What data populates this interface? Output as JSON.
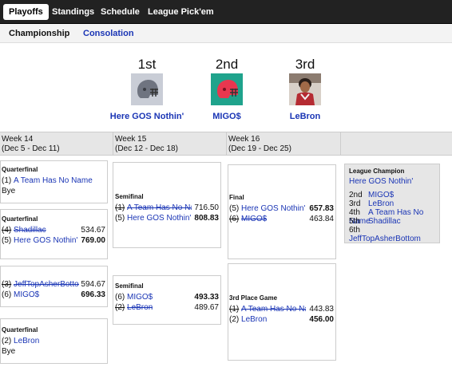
{
  "topnav": {
    "tabs": [
      {
        "label": "Playoffs"
      },
      {
        "label": "Standings"
      },
      {
        "label": "Schedule"
      },
      {
        "label": "League Pick'em"
      }
    ]
  },
  "subnav": {
    "championship": "Championship",
    "consolation": "Consolation"
  },
  "podium": [
    {
      "place": "1st",
      "team": "Here GOS Nothin'",
      "logo": "helmet-gray-icon"
    },
    {
      "place": "2nd",
      "team": "MIGO$",
      "logo": "helmet-red-icon"
    },
    {
      "place": "3rd",
      "team": "LeBron",
      "logo": "player-photo"
    }
  ],
  "weeks": [
    {
      "label": "Week 14",
      "dates": "(Dec 5 - Dec 11)"
    },
    {
      "label": "Week 15",
      "dates": "(Dec 12 - Dec 18)"
    },
    {
      "label": "Week 16",
      "dates": "(Dec 19 - Dec 25)"
    }
  ],
  "matchups": {
    "qf1": {
      "title": "Quarterfinal",
      "team1": {
        "seed": "(1)",
        "name": "A Team Has No Name"
      },
      "bye": "Bye"
    },
    "qf2": {
      "title": "Quarterfinal",
      "team1": {
        "seed": "(4)",
        "name": "Shadillac",
        "score": "534.67"
      },
      "team2": {
        "seed": "(5)",
        "name": "Here GOS Nothin'",
        "score": "769.00"
      }
    },
    "qf3": {
      "title": "Quarterfinal",
      "team1": {
        "seed": "(3)",
        "name": "JeffTopAsherBottom",
        "score": "594.67"
      },
      "team2": {
        "seed": "(6)",
        "name": "MIGO$",
        "score": "696.33"
      }
    },
    "qf4": {
      "title": "Quarterfinal",
      "team1": {
        "seed": "(2)",
        "name": "LeBron"
      },
      "bye": "Bye"
    },
    "sf1": {
      "title": "Semifinal",
      "team1": {
        "seed": "(1)",
        "name": "A Team Has No Name",
        "score": "716.50"
      },
      "team2": {
        "seed": "(5)",
        "name": "Here GOS Nothin'",
        "score": "808.83"
      }
    },
    "sf2": {
      "title": "Semifinal",
      "team1": {
        "seed": "(6)",
        "name": "MIGO$",
        "score": "493.33"
      },
      "team2": {
        "seed": "(2)",
        "name": "LeBron",
        "score": "489.67"
      }
    },
    "final": {
      "title": "Final",
      "team1": {
        "seed": "(5)",
        "name": "Here GOS Nothin'",
        "score": "657.83"
      },
      "team2": {
        "seed": "(6)",
        "name": "MIGO$",
        "score": "463.84"
      }
    },
    "third": {
      "title": "3rd Place Game",
      "team1": {
        "seed": "(1)",
        "name": "A Team Has No Name",
        "score": "443.83"
      },
      "team2": {
        "seed": "(2)",
        "name": "LeBron",
        "score": "456.00"
      }
    }
  },
  "champion": {
    "title": "League Champion",
    "winner": "Here GOS Nothin'",
    "places": [
      {
        "place": "2nd",
        "team": "MIGO$"
      },
      {
        "place": "3rd",
        "team": "LeBron"
      },
      {
        "place": "4th",
        "team": "A Team Has No Name"
      },
      {
        "place": "5th",
        "team": "Shadillac"
      },
      {
        "place": "6th",
        "team": "JeffTopAsherBottom"
      }
    ]
  },
  "colors": {
    "link": "#1a35b5",
    "nav_bg": "#222222",
    "header_bg": "#e6e6e6"
  }
}
